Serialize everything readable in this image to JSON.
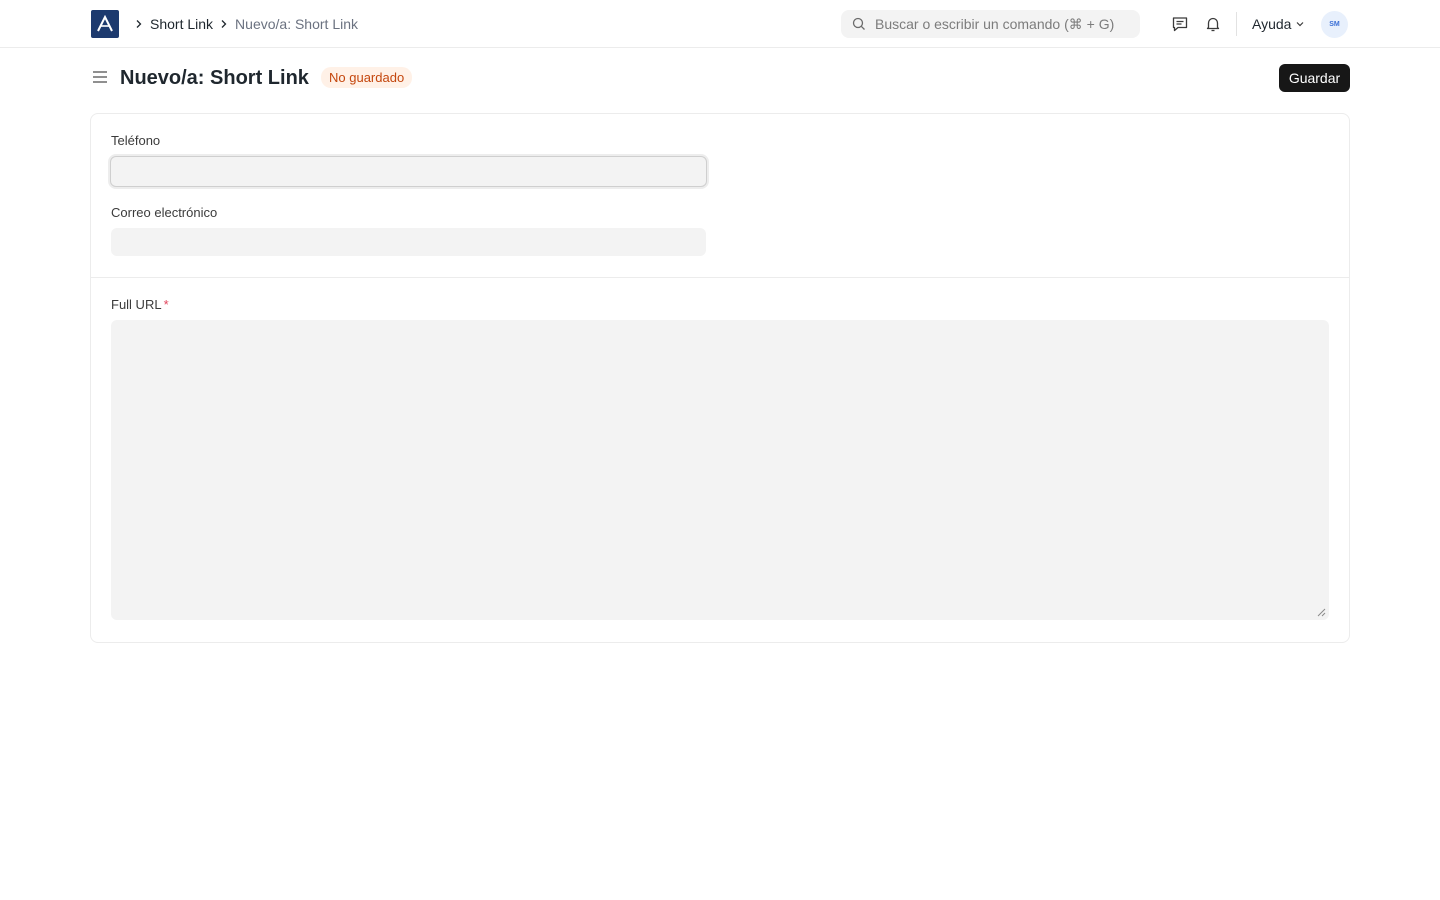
{
  "navbar": {
    "breadcrumbs": [
      "Short Link",
      "Nuevo/a: Short Link"
    ],
    "search": {
      "placeholder": "Buscar o escribir un comando (⌘ + G)"
    },
    "help_label": "Ayuda",
    "avatar_initials": "SM"
  },
  "page": {
    "title": "Nuevo/a: Short Link",
    "status": "No guardado",
    "save_label": "Guardar"
  },
  "form": {
    "fields": [
      {
        "label": "Teléfono",
        "value": "",
        "focused": true
      },
      {
        "label": "Correo electrónico",
        "value": ""
      },
      {
        "label": "Full URL",
        "value": "",
        "required": true
      }
    ],
    "required_marker": "*"
  },
  "colors": {
    "brand": "#1d3a6e",
    "primary_button": "#171717",
    "status_bg": "#fff1e7",
    "status_text": "#c4460d",
    "required": "#e2445c",
    "input_bg": "#f3f3f3"
  },
  "icons": [
    "app-logo-icon",
    "chevron-right-icon",
    "search-icon",
    "chat-icon",
    "bell-icon",
    "chevron-down-icon",
    "hamburger-menu-icon",
    "resize-grip-icon"
  ]
}
